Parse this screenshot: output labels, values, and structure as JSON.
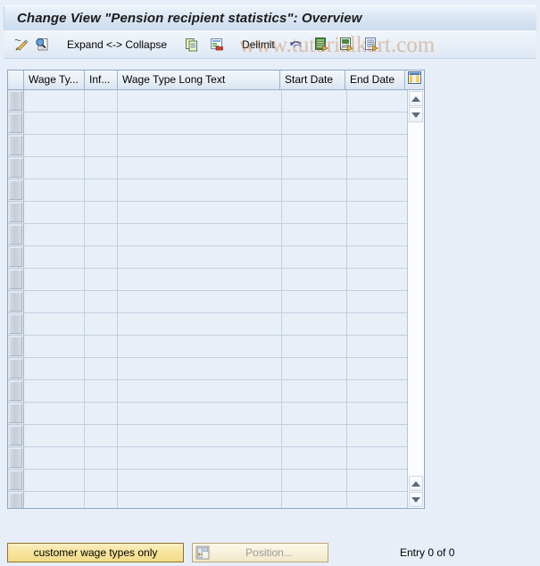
{
  "window": {
    "title": "Change View \"Pension recipient statistics\": Overview"
  },
  "toolbar": {
    "items": [
      {
        "name": "display-change-icon",
        "icon": "pencil-icon",
        "label": ""
      },
      {
        "name": "display-details-icon",
        "icon": "magnifier-document-icon",
        "label": ""
      },
      {
        "name": "expand-collapse-button",
        "icon": "",
        "label": "Expand <-> Collapse"
      },
      {
        "name": "copy-as-button",
        "icon": "copy-documents-icon",
        "label": ""
      },
      {
        "name": "delete-entry-button",
        "icon": "document-delete-icon",
        "label": ""
      },
      {
        "name": "delimit-button",
        "icon": "",
        "label": "Delimit"
      },
      {
        "name": "undo-button",
        "icon": "undo-arrow-icon",
        "label": ""
      },
      {
        "name": "select-all-button",
        "icon": "document-green-arrow-icon",
        "label": ""
      },
      {
        "name": "select-block-button",
        "icon": "document-block-arrow-icon",
        "label": ""
      },
      {
        "name": "deselect-all-button",
        "icon": "document-lines-arrow-icon",
        "label": ""
      }
    ]
  },
  "watermark": {
    "text": "www.tutorialkart.com"
  },
  "table": {
    "columns": [
      {
        "key": "wage_type",
        "label": "Wage Ty...",
        "class": "c-wagetype"
      },
      {
        "key": "inf",
        "label": "Inf...",
        "class": "c-inf"
      },
      {
        "key": "long_text",
        "label": "Wage Type Long Text",
        "class": "c-longtext"
      },
      {
        "key": "start_date",
        "label": "Start Date",
        "class": "c-start"
      },
      {
        "key": "end_date",
        "label": "End Date",
        "class": "c-end"
      }
    ],
    "config_icon": "table-settings-icon",
    "rows": [],
    "empty_row_count": 19,
    "scrollbar": {
      "up_icon": "scroll-up-arrow-icon",
      "down_icon": "scroll-down-arrow-icon"
    }
  },
  "footer": {
    "customer_button_label": "customer wage types only",
    "position_button_label": "Position...",
    "position_icon": "position-icon",
    "entry_status": "Entry 0 of 0"
  },
  "colors": {
    "background": "#e8eef7",
    "title_bar": "#dbe6f4",
    "table_border": "#8ba7c8",
    "row_bg": "#e9eff7",
    "accent_yellow": "#f7e49b",
    "watermark": "#c4783c"
  }
}
